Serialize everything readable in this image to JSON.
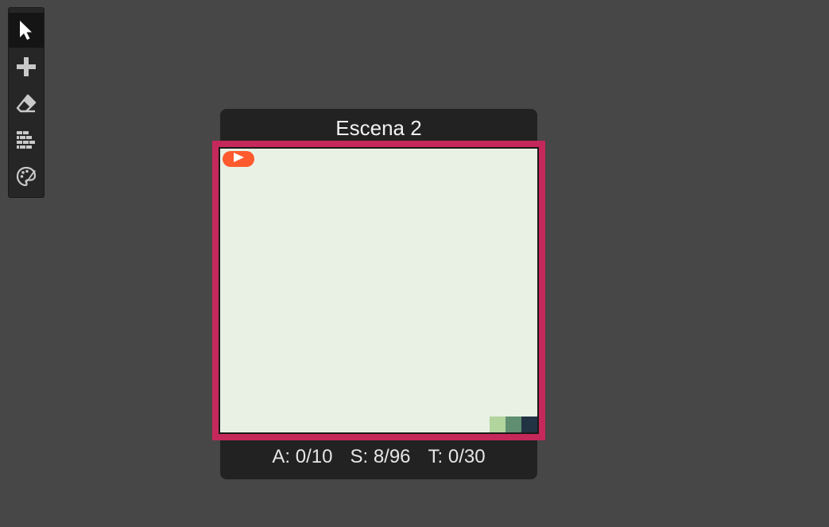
{
  "toolbar": {
    "tools": [
      {
        "name": "select",
        "icon": "pointer-icon",
        "active": true
      },
      {
        "name": "add",
        "icon": "plus-icon",
        "active": false
      },
      {
        "name": "erase",
        "icon": "eraser-icon",
        "active": false
      },
      {
        "name": "tiles",
        "icon": "bricks-icon",
        "active": false
      },
      {
        "name": "paint",
        "icon": "palette-brush-icon",
        "active": false
      }
    ]
  },
  "scene": {
    "title": "Escena 2",
    "play_icon": "play-icon",
    "palette": [
      "#b2d59e",
      "#5f8f70",
      "#223344"
    ],
    "frame_color": "#c5285a",
    "canvas_color": "#e8f1e4",
    "stats": {
      "actors": "A: 0/10",
      "sprites": "S: 8/96",
      "tiles": "T: 0/30"
    }
  }
}
